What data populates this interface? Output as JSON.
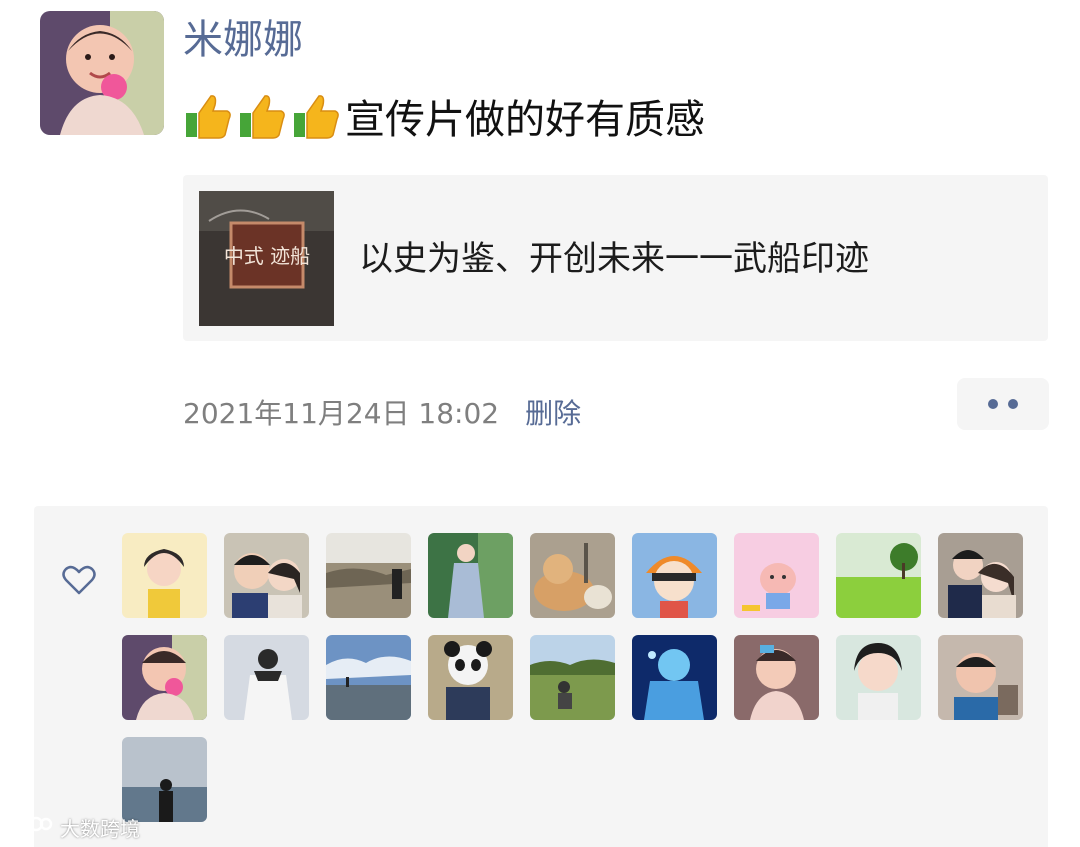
{
  "post": {
    "username": "米娜娜",
    "text": "宣传片做的好有质感",
    "emoji": [
      "thumbs-up-icon",
      "thumbs-up-icon",
      "thumbs-up-icon"
    ],
    "link": {
      "title": "以史为鉴、开创未来一一武船印迹",
      "thumb_text": "中式 迹船"
    },
    "timestamp": "2021年11月24日 18:02",
    "delete_label": "删除"
  },
  "likes": {
    "icon": "heart-outline-icon",
    "count": 19
  },
  "watermark": {
    "text": "大数跨境"
  },
  "colors": {
    "accent_link": "#576b95",
    "meta_gray": "#7f7f7f",
    "panel_bg": "#f5f5f5"
  }
}
